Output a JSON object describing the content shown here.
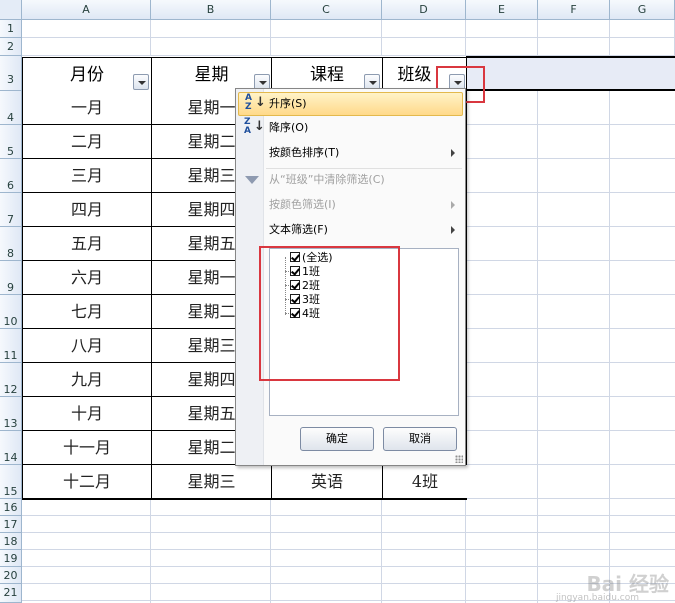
{
  "columns": [
    "A",
    "B",
    "C",
    "D",
    "E",
    "F",
    "G"
  ],
  "rows": [
    "1",
    "2",
    "3",
    "4",
    "5",
    "6",
    "7",
    "8",
    "9",
    "10",
    "11",
    "12",
    "13",
    "14",
    "15",
    "16",
    "17",
    "18",
    "19",
    "20",
    "21"
  ],
  "table": {
    "headers": [
      "月份",
      "星期",
      "课程",
      "班级"
    ],
    "data": [
      [
        "一月",
        "星期一"
      ],
      [
        "二月",
        "星期二"
      ],
      [
        "三月",
        "星期三"
      ],
      [
        "四月",
        "星期四"
      ],
      [
        "五月",
        "星期五"
      ],
      [
        "六月",
        "星期一"
      ],
      [
        "七月",
        "星期二"
      ],
      [
        "八月",
        "星期三"
      ],
      [
        "九月",
        "星期四"
      ],
      [
        "十月",
        "星期五"
      ],
      [
        "十一月",
        "星期二"
      ],
      [
        "十二月",
        "星期三",
        "英语",
        "4班"
      ]
    ]
  },
  "menu": {
    "sort_asc": "升序(S)",
    "sort_desc": "降序(O)",
    "sort_by_color": "按颜色排序(T)",
    "clear_filter": "从“班级”中清除筛选(C)",
    "filter_by_color": "按颜色筛选(I)",
    "text_filter": "文本筛选(F)",
    "checklist": [
      "(全选)",
      "1班",
      "2班",
      "3班",
      "4班"
    ],
    "ok_label": "确定",
    "cancel_label": "取消"
  },
  "watermark": {
    "brand": "Bai 经验",
    "url": "jingyan.baidu.com"
  },
  "colors": {
    "highlight_red": "#d9373f",
    "menu_highlight": "#ffd98a"
  }
}
